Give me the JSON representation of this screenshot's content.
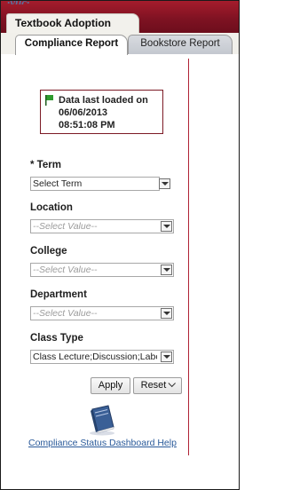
{
  "app": {
    "title": "Textbook Adoption"
  },
  "tabs": [
    {
      "label": "Compliance Report",
      "active": true
    },
    {
      "label": "Bookstore Report",
      "active": false
    }
  ],
  "notice": {
    "line1": "Data last loaded on",
    "line2": "06/06/2013",
    "line3": "08:51:08 PM",
    "icon": "green-flag-icon"
  },
  "filters": {
    "term": {
      "label": "* Term",
      "value": "Select Term"
    },
    "location": {
      "label": "Location",
      "placeholder": "--Select Value--"
    },
    "college": {
      "label": "College",
      "placeholder": "--Select Value--"
    },
    "department": {
      "label": "Department",
      "placeholder": "--Select Value--"
    },
    "class_type": {
      "label": "Class Type",
      "value": "Class Lecture;Discussion;Labora"
    }
  },
  "buttons": {
    "apply": "Apply",
    "reset": "Reset"
  },
  "help": {
    "link_text": "Compliance Status Dashboard Help",
    "icon": "help-book-icon"
  },
  "colors": {
    "banner": "#8a1526",
    "accent_red": "#b02335",
    "link": "#2a5a9a",
    "flag": "#2e9b2e"
  }
}
